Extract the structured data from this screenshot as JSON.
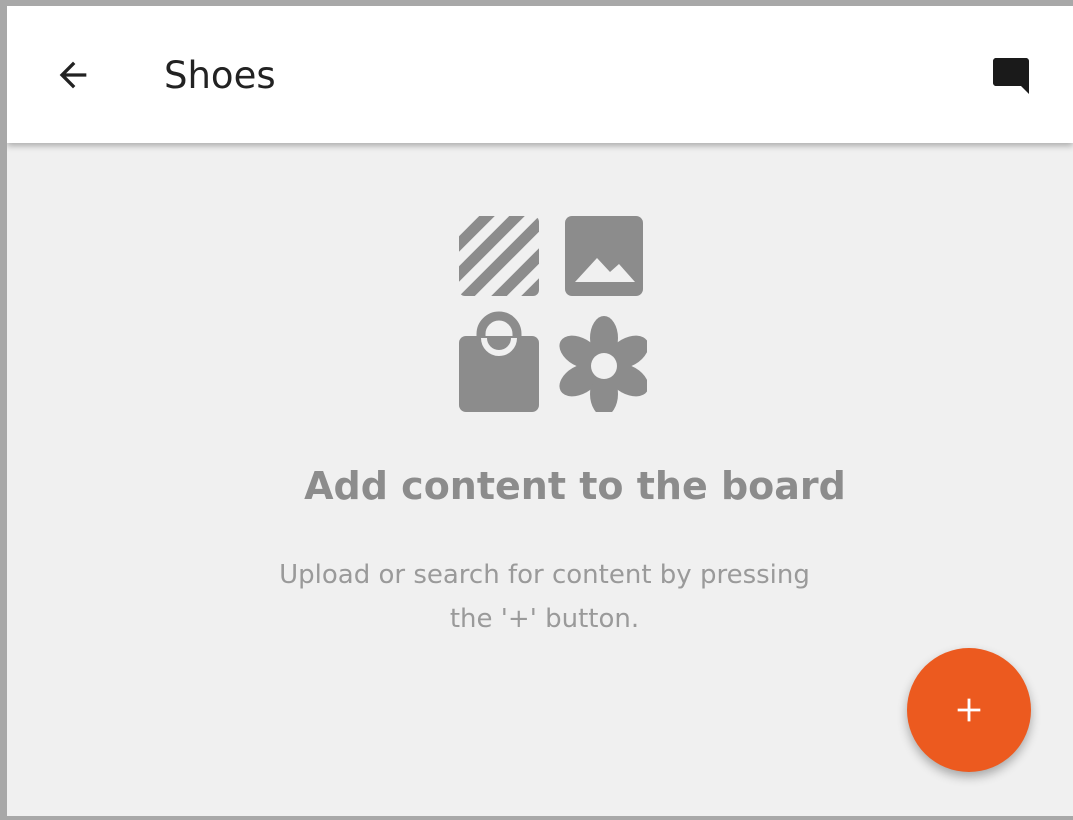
{
  "app_bar": {
    "title": "Shoes",
    "back_icon": "arrow-back-icon",
    "comment_icon": "comment-icon"
  },
  "empty_state": {
    "illustration_icons": [
      "stripes-pattern-icon",
      "image-icon",
      "shopping-bag-icon",
      "flower-icon"
    ],
    "heading": "Add content to the board",
    "text": "Upload or search for content by pressing the '+' button."
  },
  "fab": {
    "icon": "plus-icon"
  },
  "colors": {
    "accent": "#ec5a1f",
    "background": "#f0f0f0",
    "app_bar": "#ffffff",
    "icon_grey": "#8c8c8c"
  }
}
